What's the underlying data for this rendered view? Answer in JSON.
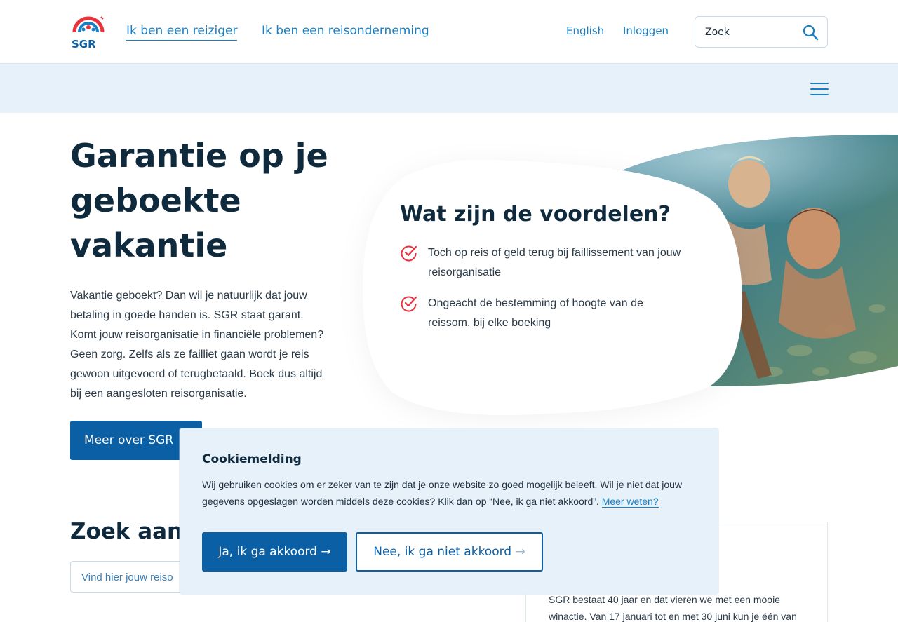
{
  "header": {
    "logo_text": "SGR",
    "nav": [
      {
        "label": "Ik ben een reiziger",
        "active": true
      },
      {
        "label": "Ik ben een reisonderneming",
        "active": false
      }
    ],
    "language_link": "English",
    "login_link": "Inloggen",
    "search_placeholder": "Zoek"
  },
  "hero": {
    "title": "Garantie op je geboekte vakantie",
    "text": "Vakantie geboekt? Dan wil je natuurlijk dat jouw betaling in goede handen is. SGR staat garant. Komt jouw reisorganisatie in financiële problemen? Geen zorg. Zelfs als ze failliet gaan wordt je reis gewoon uitgevoerd of terugbetaald. Boek dus altijd bij een aangesloten reisorganisatie.",
    "button_label": "Meer over SGR"
  },
  "benefits": {
    "title": "Wat zijn de voordelen?",
    "items": [
      "Toch op reis of geld terug bij faillissement van jouw reisorganisatie",
      "Ongeacht de bestemming of hoogte van de reissom, bij elke boeking"
    ]
  },
  "search_section": {
    "title": "Zoek aang",
    "placeholder": "Vind hier jouw reiso"
  },
  "news": {
    "text": "SGR bestaat 40 jaar en dat vieren we met een mooie winactie. Van 17 januari tot en met 30 juni kun je één van"
  },
  "cookie": {
    "title": "Cookiemelding",
    "text": "Wij gebruiken cookies om er zeker van te zijn dat je onze website zo goed mogelijk beleeft. Wil je niet dat jouw gegevens opgeslagen worden middels deze cookies? Klik dan op “Nee, ik ga niet akkoord”.",
    "more_link": "Meer weten?",
    "accept_label": "Ja, ik ga akkoord",
    "decline_label": "Nee, ik ga niet akkoord",
    "arrow": "→"
  },
  "colors": {
    "brand_blue": "#0b5fa5",
    "link_blue": "#1a7fc1",
    "light_bg": "#e7f1fa",
    "check_red": "#e8323c"
  }
}
